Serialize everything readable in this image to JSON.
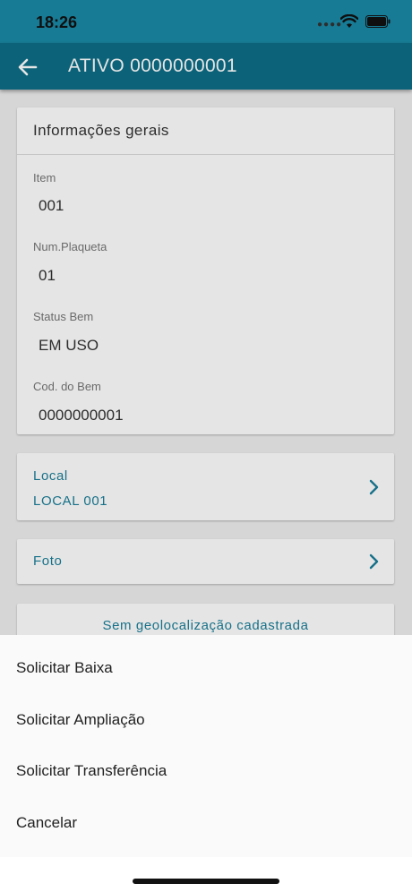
{
  "status_bar": {
    "time": "18:26",
    "signal_icon": "signal-dots-icon",
    "wifi_icon": "wifi-icon",
    "battery_icon": "battery-icon"
  },
  "app_bar": {
    "title": "ATIVO 0000000001",
    "back_icon": "arrow-left-icon"
  },
  "info_card": {
    "header": "Informações gerais",
    "fields": [
      {
        "label": "Item",
        "value": "001"
      },
      {
        "label": "Num.Plaqueta",
        "value": "01"
      },
      {
        "label": "Status Bem",
        "value": "EM USO"
      },
      {
        "label": "Cod. do Bem",
        "value": "0000000001"
      }
    ]
  },
  "local_card": {
    "title": "Local",
    "value": "LOCAL 001",
    "icon": "chevron-right-icon"
  },
  "foto_card": {
    "title": "Foto",
    "icon": "chevron-right-icon"
  },
  "geo_card": {
    "text": "Sem geolocalização cadastrada"
  },
  "action_sheet": {
    "options": [
      "Solicitar Baixa",
      "Solicitar Ampliação",
      "Solicitar Transferência",
      "Cancelar"
    ]
  },
  "colors": {
    "status_bar": "#1a8aa6",
    "app_bar": "#0e6f87",
    "accent": "#1a7e99",
    "background": "#efefef"
  }
}
